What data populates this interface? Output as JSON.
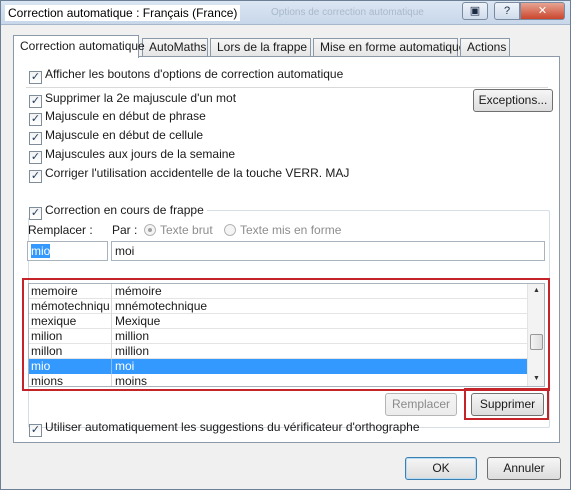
{
  "window": {
    "title": "Correction automatique : Français (France)",
    "ghost_title": "Options de correction automatique"
  },
  "tabs": [
    {
      "label": "Correction automatique",
      "active": true
    },
    {
      "label": "AutoMaths"
    },
    {
      "label": "Lors de la frappe"
    },
    {
      "label": "Mise en forme automatique"
    },
    {
      "label": "Actions"
    }
  ],
  "options": {
    "show_buttons": "Afficher les boutons d'options de correction automatique",
    "second_capital": "Supprimer la 2e majuscule d'un mot",
    "sentence_start": "Majuscule en début de phrase",
    "cell_start": "Majuscule en début de cellule",
    "weekdays": "Majuscules aux jours de la semaine",
    "caps_lock": "Corriger l'utilisation accidentelle de la touche VERR. MAJ",
    "exceptions_button": "Exceptions..."
  },
  "replace": {
    "checkbox_label": "Correction en cours de frappe",
    "replace_label": "Remplacer :",
    "by_label": "Par :",
    "plain_text": "Texte brut",
    "formatted_text": "Texte mis en forme",
    "replace_value": "mio",
    "with_value": "moi"
  },
  "entries": [
    {
      "from": "memoire",
      "to": "mémoire"
    },
    {
      "from": "mémotechnique",
      "to": "mnémotechnique"
    },
    {
      "from": "mexique",
      "to": "Mexique"
    },
    {
      "from": "milion",
      "to": "million"
    },
    {
      "from": "millon",
      "to": "million"
    },
    {
      "from": "mio",
      "to": "moi",
      "selected": true
    },
    {
      "from": "mions",
      "to": "moins"
    }
  ],
  "actions": {
    "replace_button": "Remplacer",
    "delete_button": "Supprimer",
    "spellcheck_label": "Utiliser automatiquement les suggestions du vérificateur d'orthographe"
  },
  "footer": {
    "ok": "OK",
    "cancel": "Annuler"
  },
  "colors": {
    "highlight": "#3399ff",
    "annotation_red": "#c4232a"
  }
}
